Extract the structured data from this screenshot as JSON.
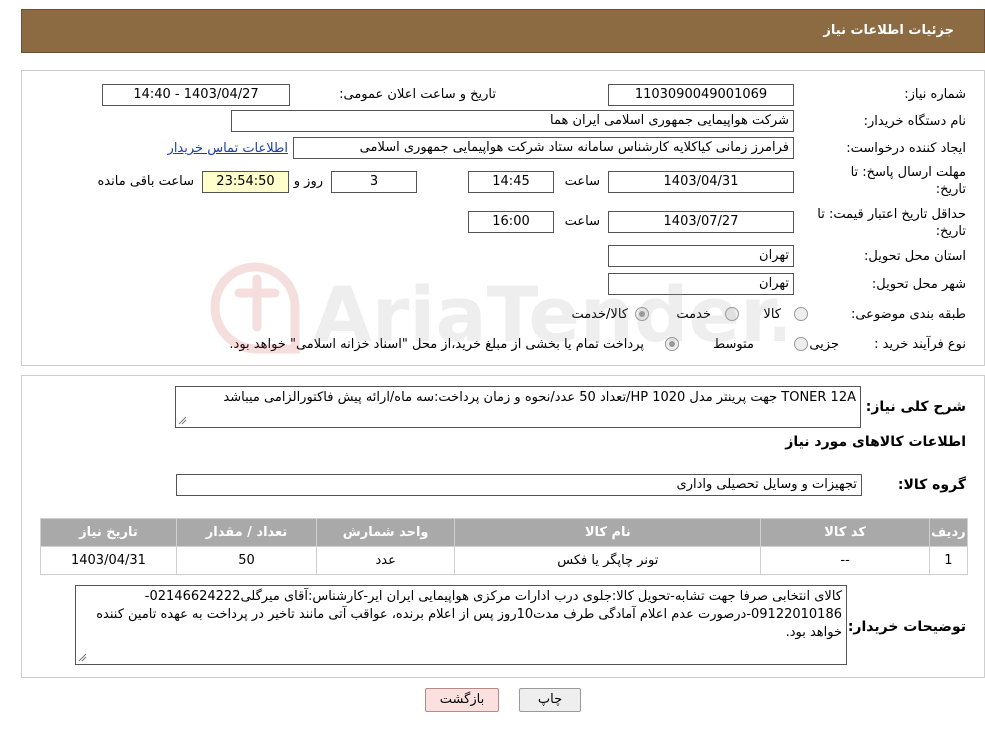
{
  "header": {
    "title": "جزئیات اطلاعات نیاز"
  },
  "form": {
    "need_number_label": "شماره نیاز:",
    "need_number": "1103090049001069",
    "announce_label": "تاریخ و ساعت اعلان عمومی:",
    "announce_value": "1403/04/27 - 14:40",
    "buyer_org_label": "نام دستگاه خریدار:",
    "buyer_org": "شرکت هواپیمایی جمهوری اسلامی ایران هما",
    "requester_label": "ایجاد کننده درخواست:",
    "requester": "فرامرز زمانی کیاکلایه کارشناس سامانه ستاد شرکت هواپیمایی جمهوری اسلامی",
    "contact_link": "اطلاعات تماس خریدار",
    "deadline_label_1": "مهلت ارسال پاسخ: تا",
    "deadline_label_2": "تاریخ:",
    "deadline_date": "1403/04/31",
    "time_label": "ساعت",
    "deadline_time": "14:45",
    "days_value": "3",
    "days_label": "روز و",
    "remaining_time": "23:54:50",
    "remaining_label": "ساعت باقی مانده",
    "validity_label_1": "حداقل تاریخ اعتبار قیمت: تا",
    "validity_label_2": "تاریخ:",
    "validity_date": "1403/07/27",
    "validity_time": "16:00",
    "province_label": "استان محل تحویل:",
    "province": "تهران",
    "city_label": "شهر محل تحویل:",
    "city": "تهران",
    "category_label": "طبقه بندی موضوعی:",
    "category_options": [
      "کالا",
      "خدمت",
      "کالا/خدمت"
    ],
    "process_label": "نوع فرآیند خرید :",
    "process_options": [
      "جزیی",
      "متوسط"
    ],
    "process_note": "پرداخت تمام یا بخشی از مبلغ خرید،از محل \"اسناد خزانه اسلامی\" خواهد بود."
  },
  "details": {
    "summary_label": "شرح کلی نیاز:",
    "summary": "TONER 12A جهت پرینتر مدل HP 1020/تعداد 50 عدد/نحوه و زمان پرداخت:سه ماه/ارائه پیش فاکتورالزامی میباشد",
    "goods_info_title": "اطلاعات کالاهای مورد نیاز",
    "goods_group_label": "گروه کالا:",
    "goods_group": "تجهیزات و وسایل تحصیلی واداری",
    "table": {
      "headers": [
        "ردیف",
        "کد کالا",
        "نام کالا",
        "واحد شمارش",
        "تعداد / مقدار",
        "تاریخ نیاز"
      ],
      "rows": [
        [
          "1",
          "--",
          "تونر چاپگر یا فکس",
          "عدد",
          "50",
          "1403/04/31"
        ]
      ]
    },
    "buyer_notes_label": "توضیحات خریدار:",
    "buyer_notes": "کالای انتخابی صرفا جهت تشابه-تحویل کالا:جلوی درب ادارات مرکزی هواپیمایی ایران ایر-کارشناس:آقای میرگلی02146624222-09122010186-درصورت عدم اعلام آمادگی طرف مدت10روز پس از اعلام برنده، عواقب آتی مانند تاخیر در پرداخت به عهده تامین کننده خواهد بود."
  },
  "buttons": {
    "print": "چاپ",
    "back": "بازگشت"
  },
  "watermark": {
    "text": "AriaTender.neT"
  }
}
